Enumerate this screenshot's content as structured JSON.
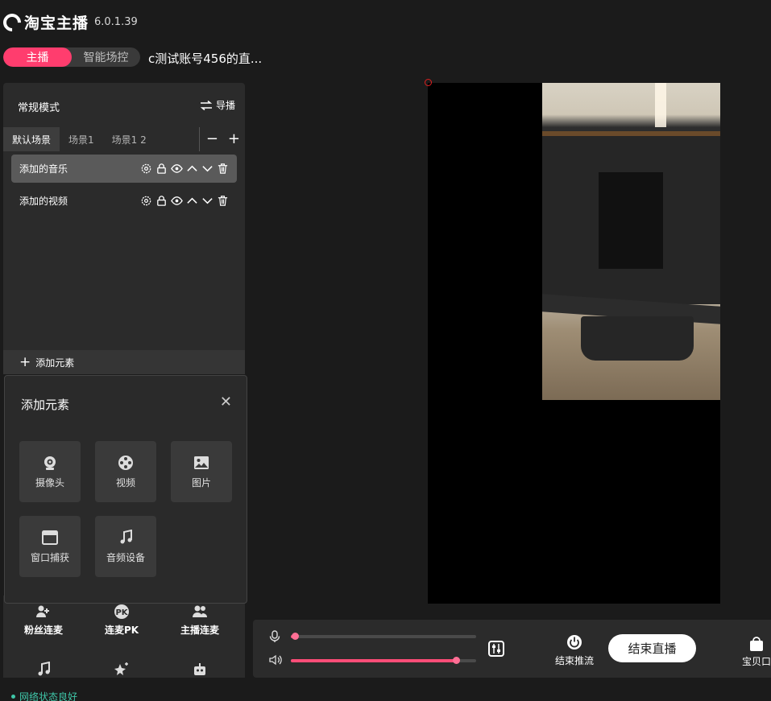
{
  "app": {
    "name": "淘宝主播",
    "version": "6.0.1.39"
  },
  "mode_toggle": {
    "host_label": "主播",
    "smart_label": "智能场控"
  },
  "account_title": "c测试账号456的直...",
  "panel": {
    "mode_title": "常规模式",
    "director_label": "导播",
    "scene_tabs": [
      "默认场景",
      "场景1",
      "场景1 2"
    ],
    "elements": [
      "添加的音乐",
      "添加的视频"
    ],
    "add_element_label": "添加元素"
  },
  "popup": {
    "title": "添加元素",
    "tiles": [
      {
        "label": "摄像头",
        "icon": "webcam-icon"
      },
      {
        "label": "视频",
        "icon": "film-reel-icon"
      },
      {
        "label": "图片",
        "icon": "image-icon"
      },
      {
        "label": "窗口捕获",
        "icon": "window-icon"
      },
      {
        "label": "音频设备",
        "icon": "music-note-icon"
      }
    ]
  },
  "bottom_grid": {
    "items": [
      "粉丝连麦",
      "连麦PK",
      "主播连麦"
    ],
    "pk_badge": "PK"
  },
  "controls": {
    "mic_level": 0.02,
    "volume_level": 0.89,
    "stop_push_label": "结束推流",
    "end_live_label": "结束直播",
    "baby_port_label": "宝贝口"
  },
  "status": {
    "network": "网络状态良好"
  }
}
